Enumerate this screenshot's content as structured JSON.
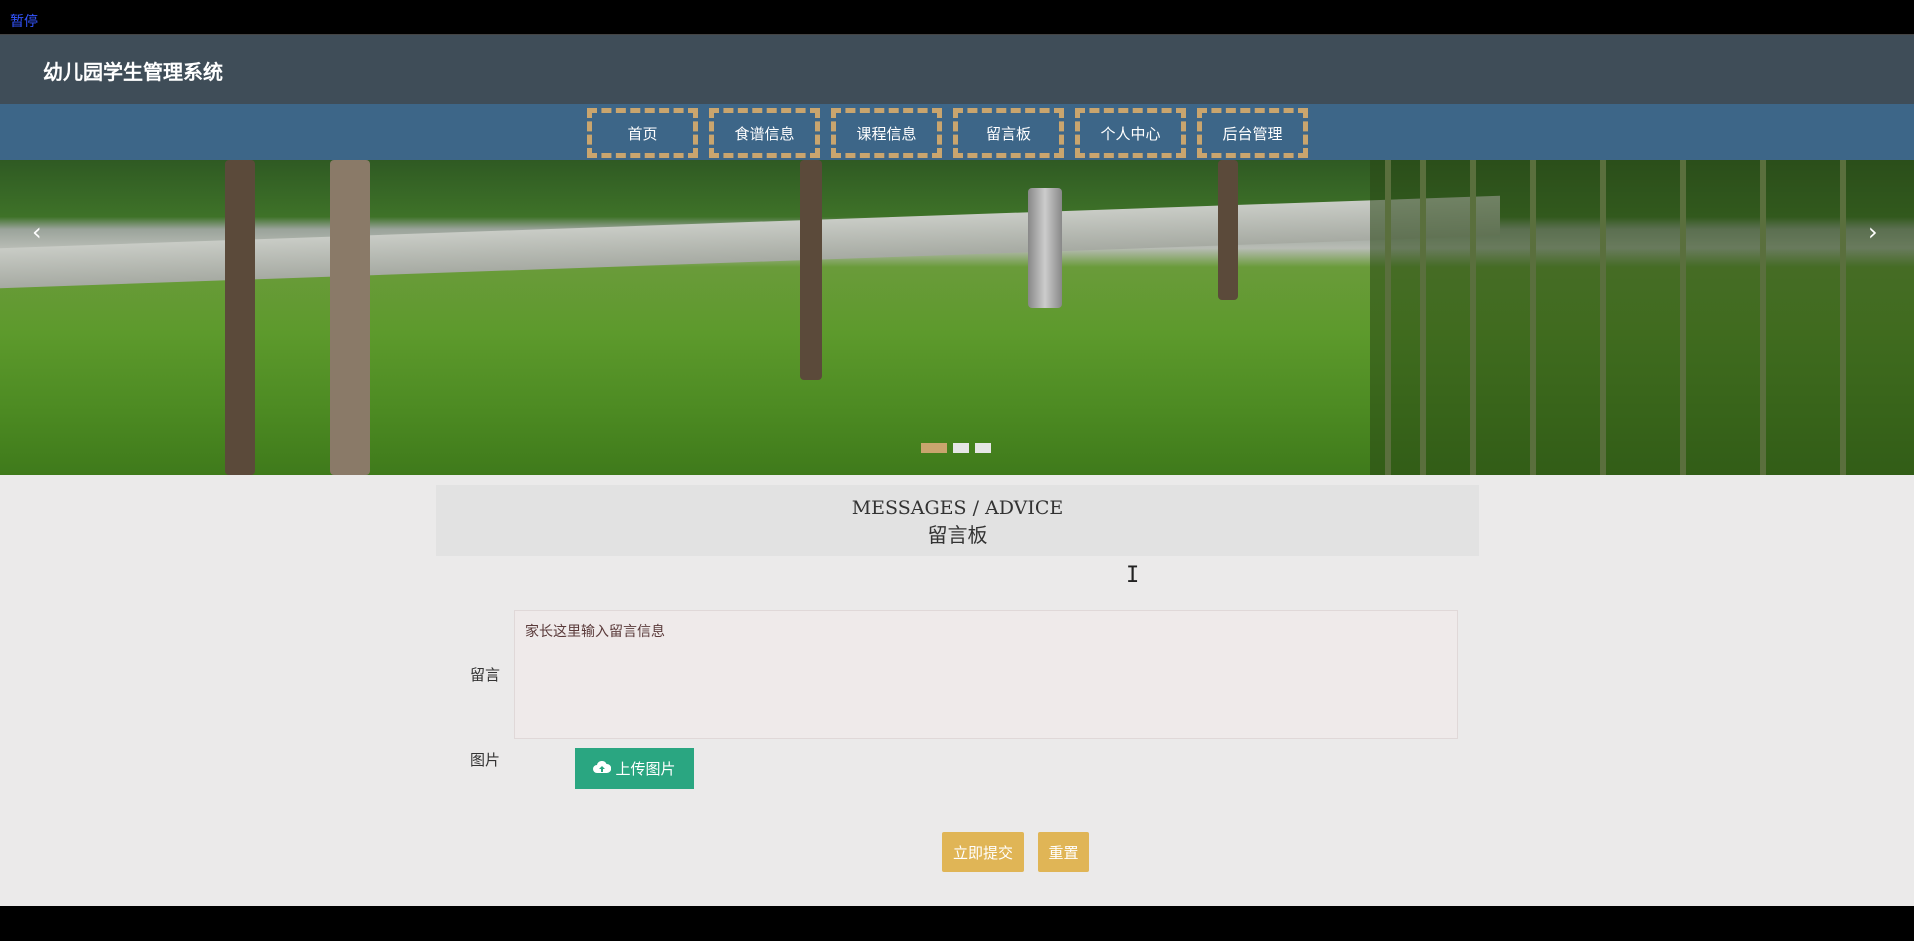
{
  "topbar": {
    "pause_label": "暂停"
  },
  "header": {
    "title": "幼儿园学生管理系统"
  },
  "nav": {
    "items": [
      {
        "label": "首页"
      },
      {
        "label": "食谱信息"
      },
      {
        "label": "课程信息"
      },
      {
        "label": "留言板"
      },
      {
        "label": "个人中心"
      },
      {
        "label": "后台管理"
      }
    ]
  },
  "banner": {
    "prev_icon": "chevron-left-icon",
    "next_icon": "chevron-right-icon",
    "prev_glyph": "‹",
    "next_glyph": "›",
    "slide_count": 3,
    "active_slide": 1
  },
  "section": {
    "title_en": "MESSAGES / ADVICE",
    "title_zh": "留言板"
  },
  "form": {
    "message_label": "留言",
    "message_placeholder": "家长这里输入留言信息",
    "image_label": "图片",
    "upload_label": "上传图片",
    "upload_icon": "cloud-upload-icon",
    "submit_label": "立即提交",
    "reset_label": "重置"
  },
  "colors": {
    "header_bg": "#3f4d58",
    "nav_bg": "#3d6688",
    "nav_border": "#c9a56e",
    "upload_btn": "#2aa681",
    "action_btn": "#e0b556",
    "content_bg": "#ebeaea"
  }
}
